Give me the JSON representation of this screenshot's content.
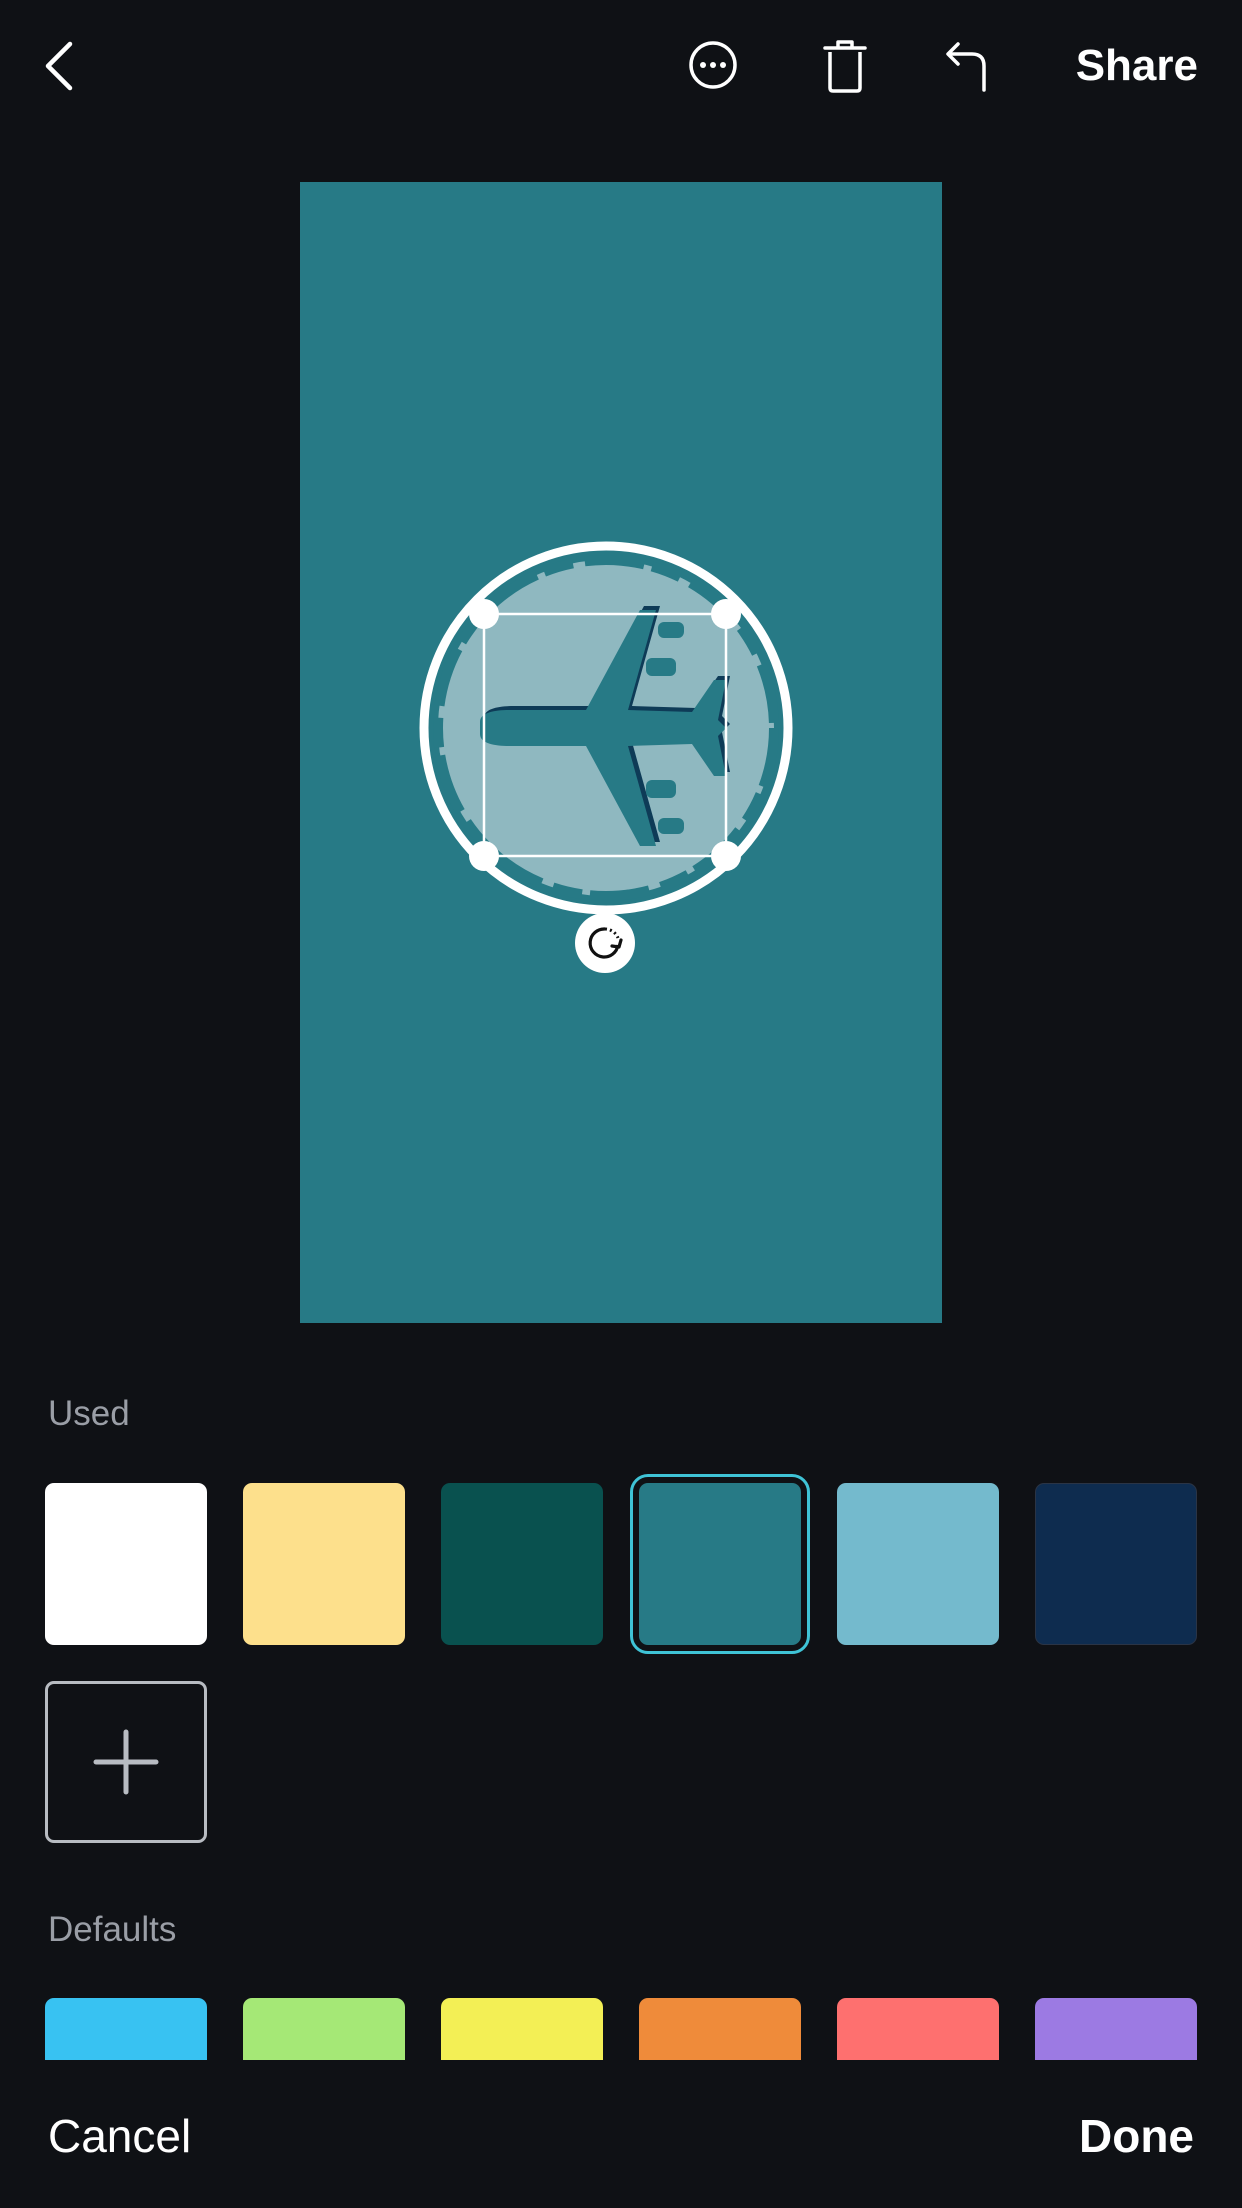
{
  "toolbar": {
    "back_icon": "chevron-left-icon",
    "more_icon": "more-dots-icon",
    "delete_icon": "trash-icon",
    "undo_icon": "undo-icon",
    "share_label": "Share"
  },
  "canvas": {
    "background": "#277a86",
    "sticker": "airplane-globe-sticker",
    "rotate_icon": "rotate-icon"
  },
  "used": {
    "label": "Used",
    "colors": [
      "#ffffff",
      "#fde08c",
      "#09514f",
      "#277a86",
      "#74bacd",
      "#0e2c4f"
    ],
    "selected": "#277a86",
    "add_icon": "plus-icon"
  },
  "defaults": {
    "label": "Defaults",
    "colors": [
      "#38c2f2",
      "#a5e876",
      "#f3ef55",
      "#ef8b3a",
      "#fe706f",
      "#9c7ae3"
    ]
  },
  "footer": {
    "cancel_label": "Cancel",
    "done_label": "Done"
  }
}
